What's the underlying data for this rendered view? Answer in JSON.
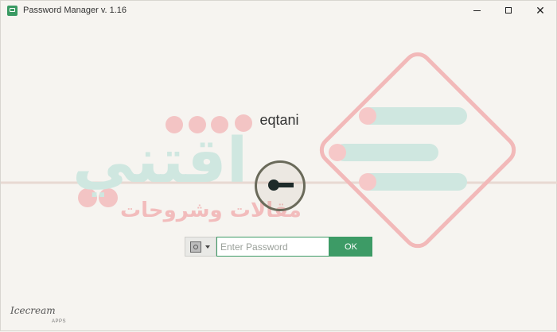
{
  "window": {
    "title": "Password Manager v. 1.16",
    "controls": {
      "minimize": "minimize",
      "maximize": "maximize",
      "close": "✕"
    }
  },
  "watermark": {
    "arabic_main": "اقتني",
    "arabic_sub": "مقالات وشروحات"
  },
  "login": {
    "username": "eqtani",
    "password_placeholder": "Enter Password",
    "password_value": "",
    "ok_label": "OK"
  },
  "brand": {
    "name": "Icecream",
    "sub": "APPS"
  },
  "colors": {
    "accent": "#3d9b66",
    "background": "#f6f4f0",
    "watermark_teal": "#cfe7e0",
    "watermark_red": "#f3b8b8"
  }
}
